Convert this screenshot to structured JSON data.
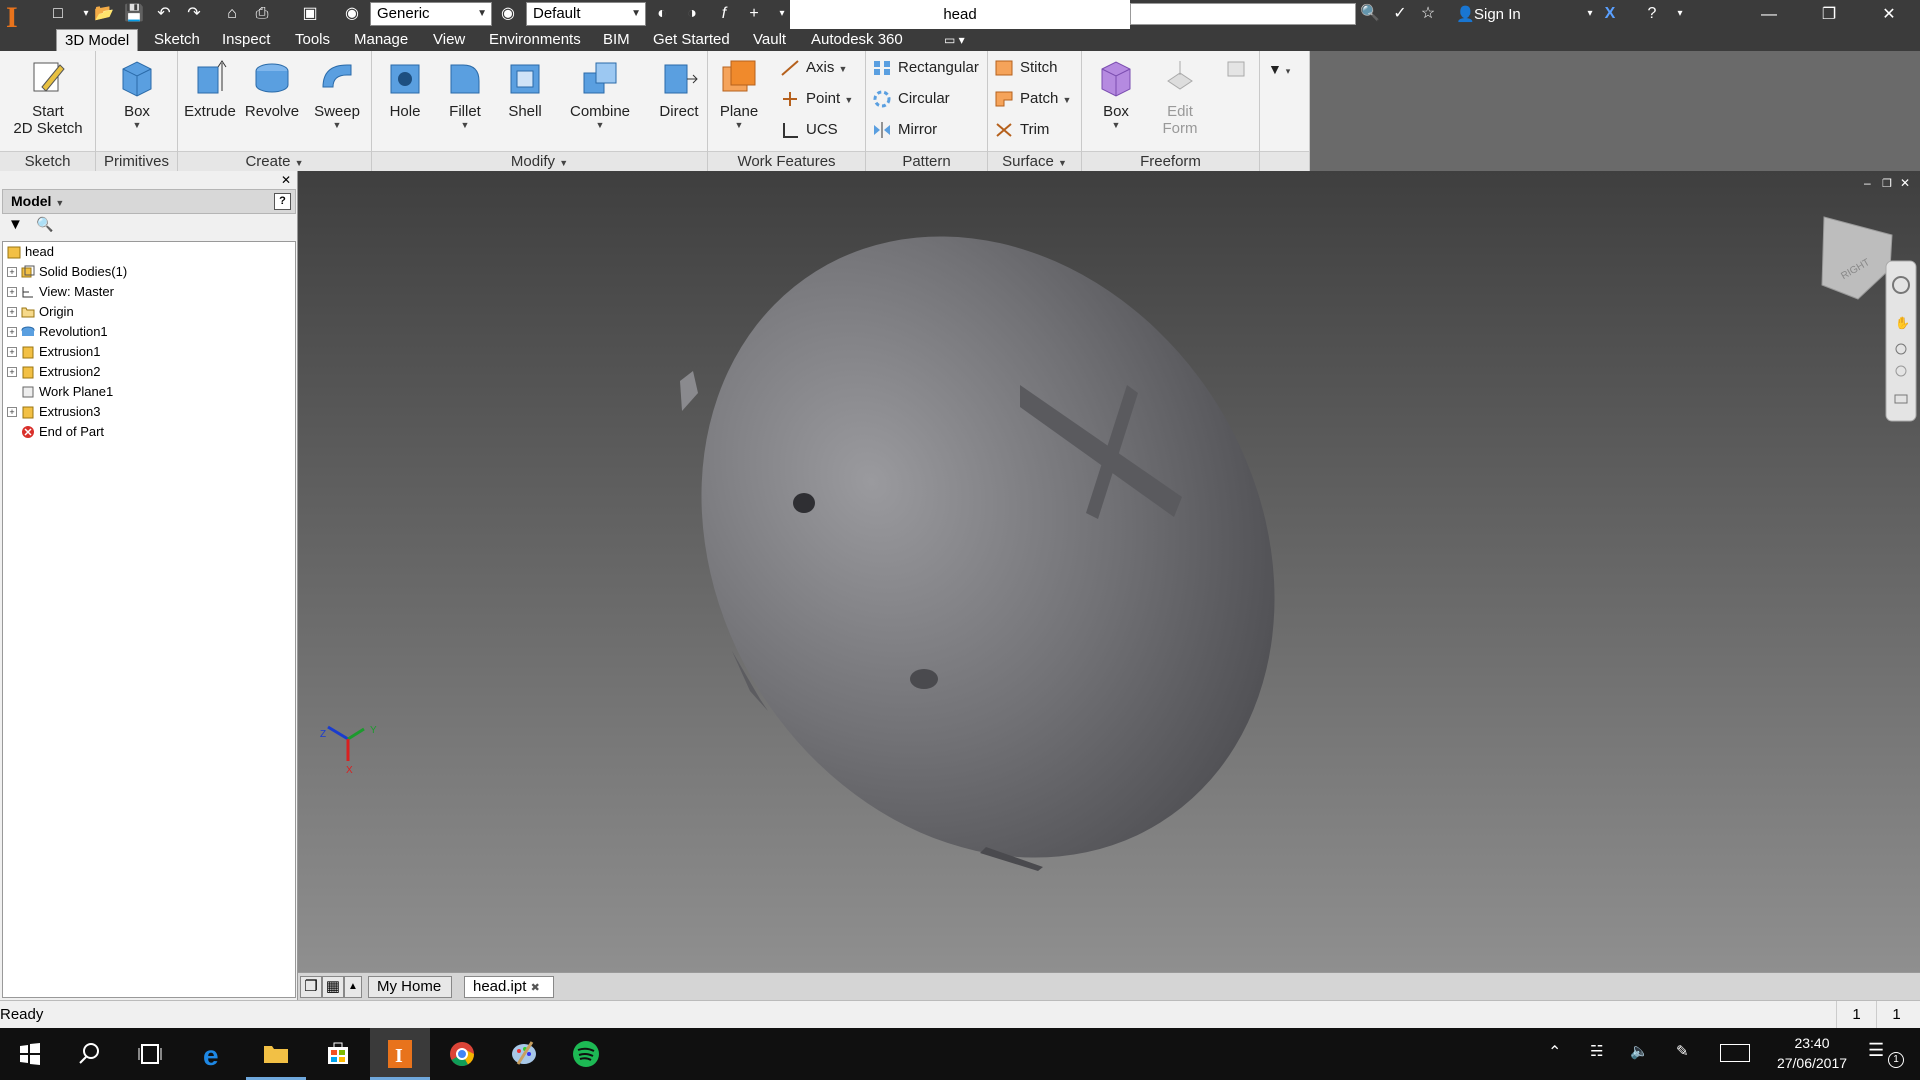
{
  "titlebar": {
    "material": "Generic",
    "appearance": "Default",
    "doc_title": "head",
    "sign_in": "Sign In"
  },
  "tabs": [
    "3D Model",
    "Sketch",
    "Inspect",
    "Tools",
    "Manage",
    "View",
    "Environments",
    "BIM",
    "Get Started",
    "Vault",
    "Autodesk 360"
  ],
  "ribbon": {
    "sketch": {
      "label": "Sketch",
      "start_line1": "Start",
      "start_line2": "2D Sketch"
    },
    "primitives": {
      "label": "Primitives",
      "box": "Box"
    },
    "create": {
      "label": "Create",
      "extrude": "Extrude",
      "revolve": "Revolve",
      "sweep": "Sweep"
    },
    "modify": {
      "label": "Modify",
      "hole": "Hole",
      "fillet": "Fillet",
      "shell": "Shell",
      "combine": "Combine",
      "direct": "Direct"
    },
    "work": {
      "label": "Work Features",
      "plane": "Plane",
      "axis": "Axis",
      "point": "Point",
      "ucs": "UCS"
    },
    "pattern": {
      "label": "Pattern",
      "rect": "Rectangular",
      "circ": "Circular",
      "mirror": "Mirror"
    },
    "surface": {
      "label": "Surface",
      "stitch": "Stitch",
      "patch": "Patch",
      "trim": "Trim"
    },
    "freeform": {
      "label": "Freeform",
      "box": "Box",
      "edit_line1": "Edit",
      "edit_line2": "Form"
    }
  },
  "browser": {
    "title": "Model",
    "tree": [
      "head",
      "Solid Bodies(1)",
      "View: Master",
      "Origin",
      "Revolution1",
      "Extrusion1",
      "Extrusion2",
      "Work Plane1",
      "Extrusion3",
      "End of Part"
    ]
  },
  "viewcube_label": "RIGHT",
  "triad": {
    "x": "X",
    "y": "Y",
    "z": "Z"
  },
  "doc_tabs": {
    "home": "My Home",
    "file": "head.ipt"
  },
  "status": {
    "text": "Ready",
    "count1": "1",
    "count2": "1"
  },
  "clock": {
    "time": "23:40",
    "date": "27/06/2017"
  },
  "notifications": "1",
  "colors": {
    "accent": "#e8731c",
    "titlebar": "#3b3b3b",
    "taskbar": "#101010",
    "spotify": "#1db954"
  }
}
